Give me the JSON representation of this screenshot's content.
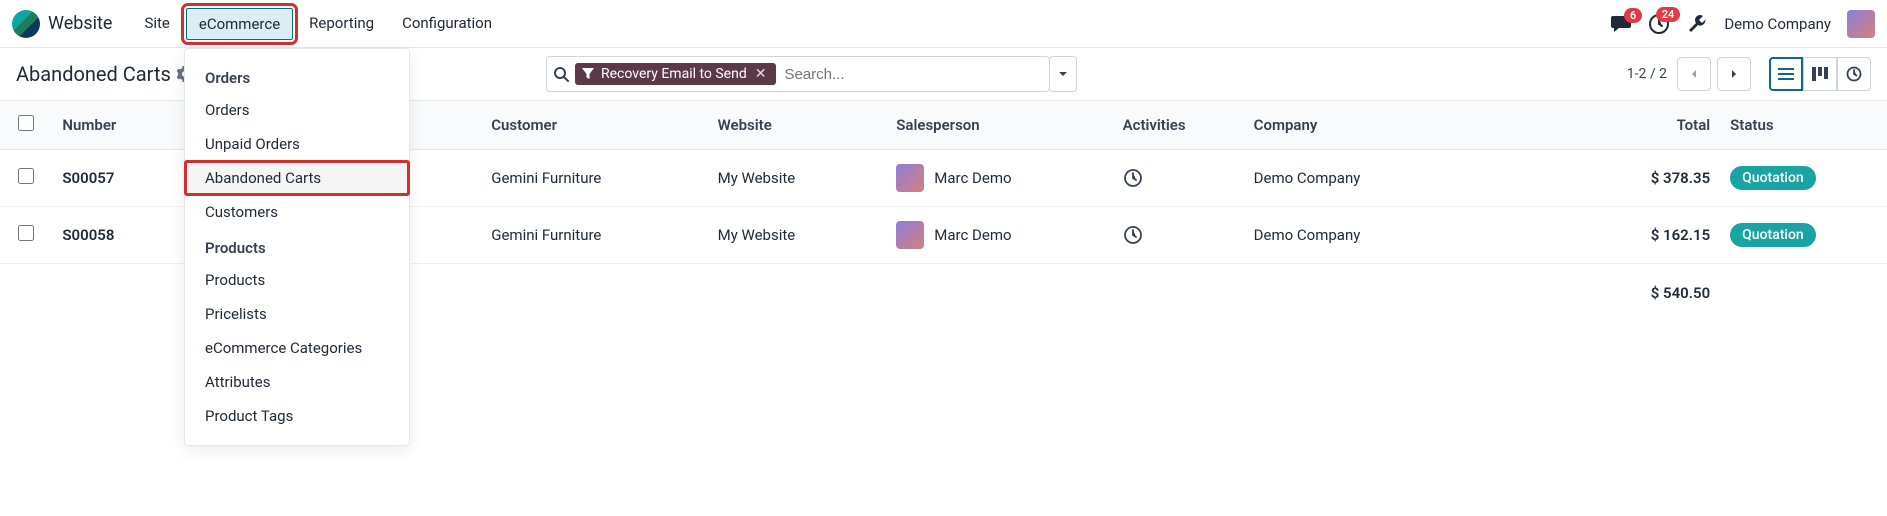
{
  "app": {
    "name": "Website"
  },
  "topMenu": {
    "items": [
      {
        "label": "Site"
      },
      {
        "label": "eCommerce",
        "active": true,
        "highlighted": true
      },
      {
        "label": "Reporting"
      },
      {
        "label": "Configuration"
      }
    ]
  },
  "notifications": {
    "messages": "6",
    "activities": "24"
  },
  "company": {
    "name": "Demo Company"
  },
  "dropdown": {
    "groups": [
      {
        "label": "Orders",
        "items": [
          {
            "label": "Orders"
          },
          {
            "label": "Unpaid Orders"
          },
          {
            "label": "Abandoned Carts",
            "highlighted": true
          },
          {
            "label": "Customers"
          }
        ]
      },
      {
        "label": "Products",
        "items": [
          {
            "label": "Products"
          },
          {
            "label": "Pricelists"
          },
          {
            "label": "eCommerce Categories"
          },
          {
            "label": "Attributes"
          },
          {
            "label": "Product Tags"
          }
        ]
      }
    ]
  },
  "page": {
    "title": "Abandoned Carts"
  },
  "search": {
    "filterLabel": "Recovery Email to Send",
    "placeholder": "Search..."
  },
  "pager": {
    "text": "1-2 / 2"
  },
  "table": {
    "headers": {
      "number": "Number",
      "customer": "Customer",
      "website": "Website",
      "salesperson": "Salesperson",
      "activities": "Activities",
      "company": "Company",
      "total": "Total",
      "status": "Status"
    },
    "rows": [
      {
        "number": "S00057",
        "datePartial": "0",
        "customer": "Gemini Furniture",
        "website": "My Website",
        "salesperson": "Marc Demo",
        "company": "Demo Company",
        "total": "$ 378.35",
        "status": "Quotation"
      },
      {
        "number": "S00058",
        "datePartial": "0",
        "customer": "Gemini Furniture",
        "website": "My Website",
        "salesperson": "Marc Demo",
        "company": "Demo Company",
        "total": "$ 162.15",
        "status": "Quotation"
      }
    ],
    "footer": {
      "total": "$ 540.50"
    }
  }
}
